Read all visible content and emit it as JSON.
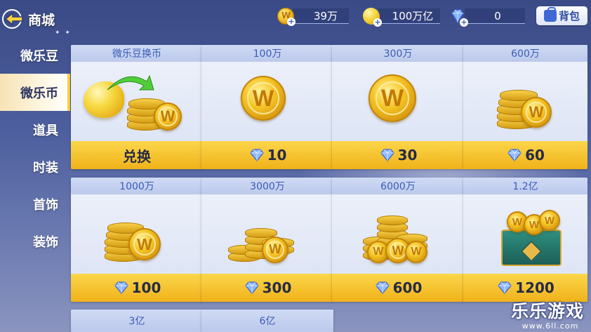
{
  "header": {
    "title": "商城",
    "resources": [
      {
        "icon": "w-coin-icon",
        "value": "39万"
      },
      {
        "icon": "bean-icon",
        "value": "100万亿"
      },
      {
        "icon": "diamond-icon",
        "value": "0"
      }
    ],
    "bag_label": "背包"
  },
  "sidebar": {
    "items": [
      {
        "label": "微乐豆",
        "active": false
      },
      {
        "label": "微乐币",
        "active": true
      },
      {
        "label": "道具",
        "active": false
      },
      {
        "label": "时装",
        "active": false
      },
      {
        "label": "首饰",
        "active": false
      },
      {
        "label": "装饰",
        "active": false
      }
    ]
  },
  "products": [
    {
      "title": "微乐豆换币",
      "price": "兑换",
      "art": "exchange",
      "currency": "none"
    },
    {
      "title": "100万",
      "price": "10",
      "art": "coin-single",
      "currency": "diamond"
    },
    {
      "title": "300万",
      "price": "30",
      "art": "coin-single",
      "currency": "diamond"
    },
    {
      "title": "600万",
      "price": "60",
      "art": "coin-stack",
      "currency": "diamond"
    },
    {
      "title": "1000万",
      "price": "100",
      "art": "coin-stack",
      "currency": "diamond"
    },
    {
      "title": "3000万",
      "price": "300",
      "art": "coin-pile",
      "currency": "diamond"
    },
    {
      "title": "6000万",
      "price": "600",
      "art": "coin-pile-large",
      "currency": "diamond"
    },
    {
      "title": "1.2亿",
      "price": "1200",
      "art": "coin-chest",
      "currency": "diamond"
    },
    {
      "title": "3亿",
      "price": "",
      "art": "",
      "currency": "diamond"
    },
    {
      "title": "6亿",
      "price": "",
      "art": "",
      "currency": "diamond"
    }
  ],
  "watermark": {
    "text": "乐乐游戏",
    "sub": "www.6ll.com"
  },
  "colors": {
    "accent": "#f3c02b",
    "card_title": "#3a5bb7",
    "active_tab": "#fff8e6"
  }
}
